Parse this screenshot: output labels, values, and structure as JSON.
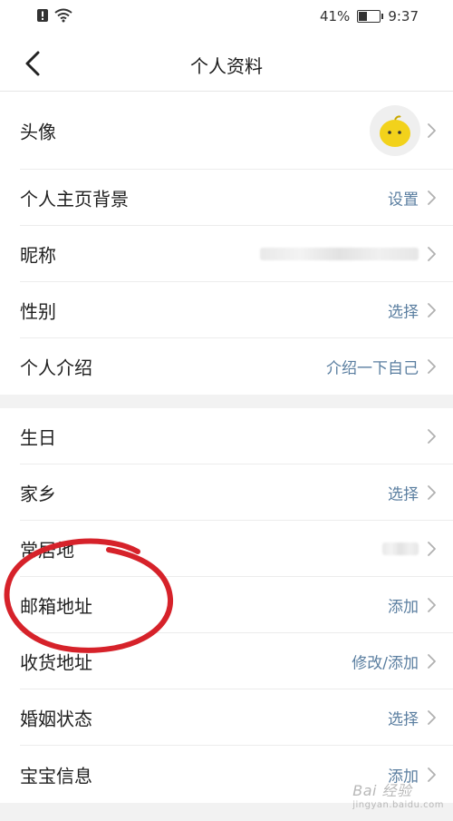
{
  "status_bar": {
    "battery": "41%",
    "battery_level": 0.41,
    "time": "9:37"
  },
  "nav": {
    "title": "个人资料"
  },
  "group1": [
    {
      "key": "avatar",
      "label": "头像",
      "value": ""
    },
    {
      "key": "homepage-bg",
      "label": "个人主页背景",
      "value": "设置"
    },
    {
      "key": "nickname",
      "label": "昵称",
      "value": ""
    },
    {
      "key": "gender",
      "label": "性别",
      "value": "选择"
    },
    {
      "key": "intro",
      "label": "个人介绍",
      "value": "介绍一下自己"
    }
  ],
  "group2": [
    {
      "key": "birthday",
      "label": "生日",
      "value": ""
    },
    {
      "key": "hometown",
      "label": "家乡",
      "value": "选择"
    },
    {
      "key": "residence",
      "label": "常居地",
      "value": ""
    },
    {
      "key": "email",
      "label": "邮箱地址",
      "value": "添加"
    },
    {
      "key": "shipping-address",
      "label": "收货地址",
      "value": "修改/添加"
    },
    {
      "key": "marital-status",
      "label": "婚姻状态",
      "value": "选择"
    },
    {
      "key": "baby-info",
      "label": "宝宝信息",
      "value": "添加"
    }
  ],
  "watermark": {
    "text": "Bai 经验",
    "sub": "jingyan.baidu.com"
  },
  "colors": {
    "link": "#5a7ea0",
    "annotation": "#d6222a",
    "avatar": "#f2d21b"
  }
}
